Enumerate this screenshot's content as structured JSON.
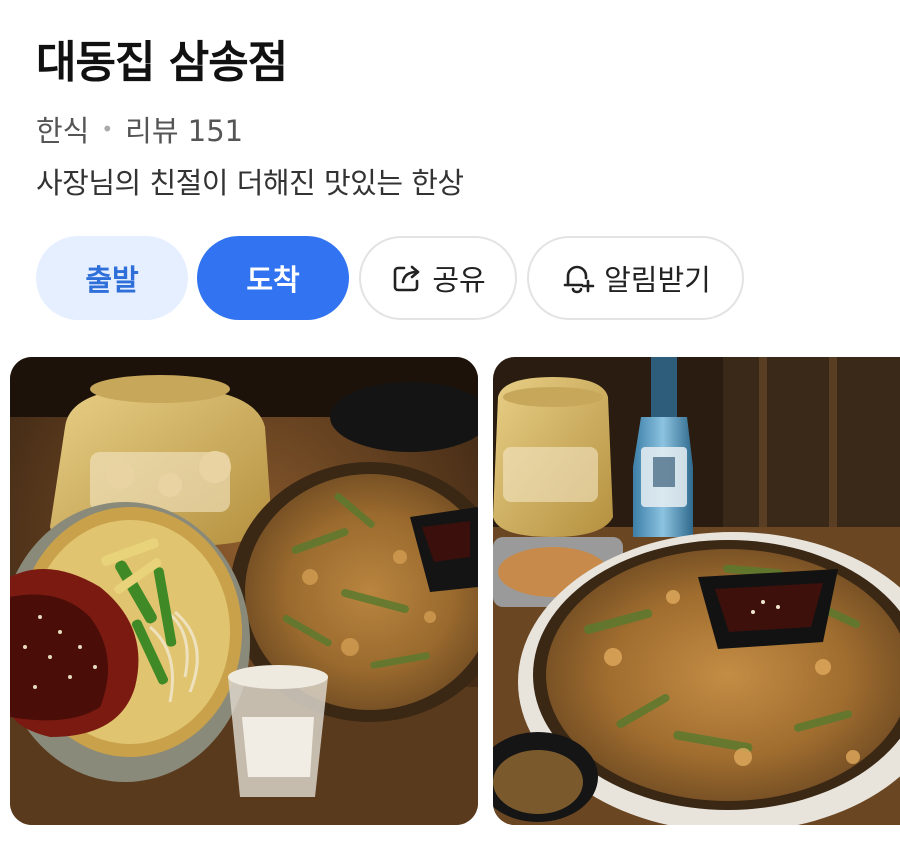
{
  "place": {
    "name": "대동집 삼송점",
    "category": "한식",
    "review_label": "리뷰 151",
    "description": "사장님의 친절이 더해진 맛있는 한상"
  },
  "actions": {
    "depart": "출발",
    "arrive": "도착",
    "share": "공유",
    "alarm": "알림받기"
  },
  "photos": [
    {
      "alt": "bibimbap noodles, green onion pancake and soju glass"
    },
    {
      "alt": "green onion pancake with dipping sauce and soju bottle"
    }
  ],
  "colors": {
    "accent": "#3173f0",
    "accent_light": "#e6efff",
    "accent_text": "#2f6fd9"
  }
}
